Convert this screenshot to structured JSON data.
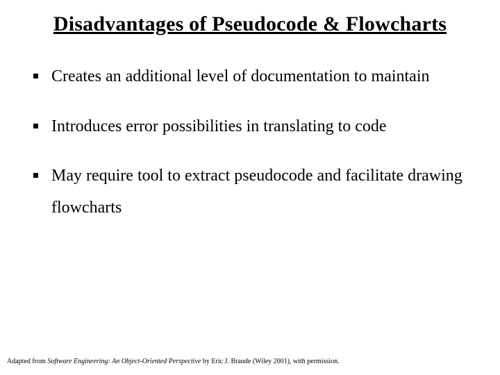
{
  "title": "Disadvantages of Pseudocode & Flowcharts",
  "bullets": {
    "b1": "Creates an additional level of documentation to maintain",
    "b2": "Introduces error possibilities in translating to code",
    "b3": "May require tool to extract pseudocode and facilitate drawing flowcharts"
  },
  "footer": {
    "prefix": "Adapted from ",
    "book": "Software Engineering: An Object-Oriented Perspective",
    "suffix": " by Eric J. Braude (Wiley 2001), with permission."
  }
}
